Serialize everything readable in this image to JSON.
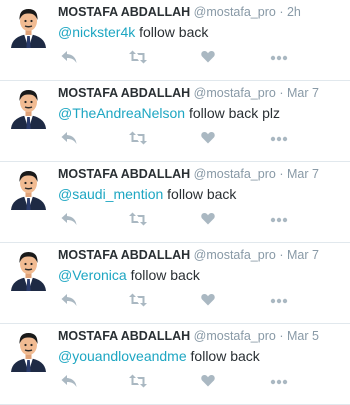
{
  "colors": {
    "mention": "#1da6c2",
    "meta": "#8899a6",
    "icon": "#aab8c2",
    "divider": "#e1e8ed"
  },
  "icons": {
    "reply": "reply-icon",
    "retweet": "retweet-icon",
    "like": "heart-icon",
    "more": "more-dots-icon"
  },
  "tweets": [
    {
      "name": "MOSTAFA ABDALLAH",
      "handle": "@mostafa_pro",
      "separator": "·",
      "time": "2h",
      "mention": "@nickster4k",
      "text": " follow back"
    },
    {
      "name": "MOSTAFA ABDALLAH",
      "handle": "@mostafa_pro",
      "separator": "·",
      "time": "Mar 7",
      "mention": "@TheAndreaNelson",
      "text": " follow back plz"
    },
    {
      "name": "MOSTAFA ABDALLAH",
      "handle": "@mostafa_pro",
      "separator": "·",
      "time": "Mar 7",
      "mention": "@saudi_mention",
      "text": " follow back"
    },
    {
      "name": "MOSTAFA ABDALLAH",
      "handle": "@mostafa_pro",
      "separator": "·",
      "time": "Mar 7",
      "mention": "@Veronica",
      "text": " follow back"
    },
    {
      "name": "MOSTAFA ABDALLAH",
      "handle": "@mostafa_pro",
      "separator": "·",
      "time": "Mar 5",
      "mention": "@youandloveandme",
      "text": " follow back"
    }
  ]
}
